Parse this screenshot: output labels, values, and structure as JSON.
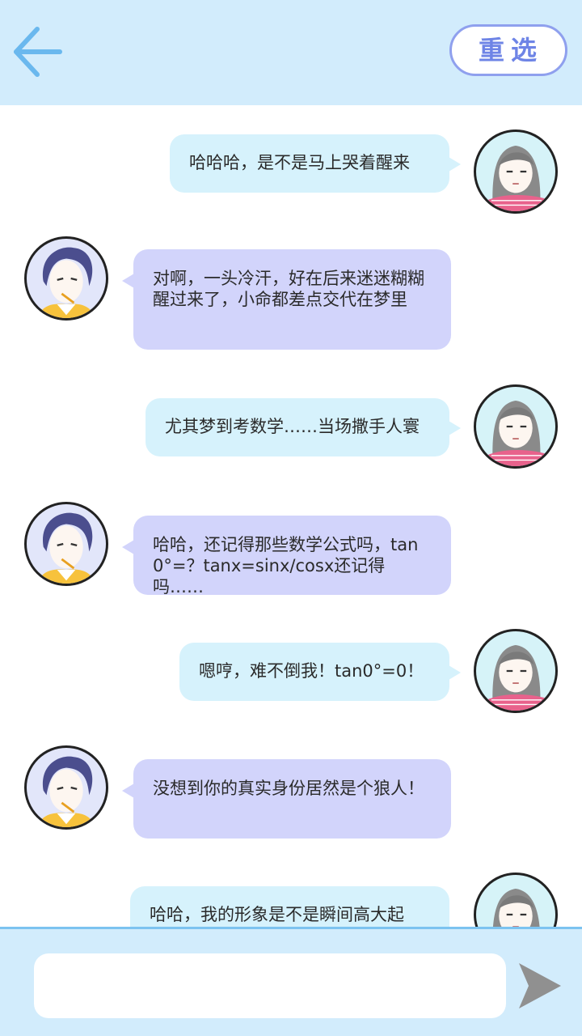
{
  "header": {
    "back_icon": "arrow-left-icon",
    "reselect_label": "重选"
  },
  "messages": [
    {
      "side": "me",
      "avatar": "girl-avatar",
      "text": "哈哈哈，是不是马上哭着醒来"
    },
    {
      "side": "other",
      "avatar": "boy-avatar",
      "text": "对啊，一头冷汗，好在后来迷迷糊糊醒过来了，小命都差点交代在梦里"
    },
    {
      "side": "me",
      "avatar": "girl-avatar",
      "text": "尤其梦到考数学……当场撒手人寰"
    },
    {
      "side": "other",
      "avatar": "boy-avatar",
      "text": "哈哈，还记得那些数学公式吗，tan0°=？tanx=sinx/cosx还记得吗……"
    },
    {
      "side": "me",
      "avatar": "girl-avatar",
      "text": "嗯哼，难不倒我！tan0°=0！"
    },
    {
      "side": "other",
      "avatar": "boy-avatar",
      "text": "没想到你的真实身份居然是个狼人！"
    },
    {
      "side": "me",
      "avatar": "girl-avatar",
      "text": "哈哈，我的形象是不是瞬间高大起"
    }
  ],
  "input": {
    "value": "",
    "placeholder": ""
  },
  "send_icon": "send-icon",
  "colors": {
    "header_bg": "#d2ecfc",
    "accent_blue": "#6ab8ee",
    "me_bubble": "#d6f2fc",
    "other_bubble": "#d2d4fb",
    "reselect_border": "#8fa0ee"
  }
}
